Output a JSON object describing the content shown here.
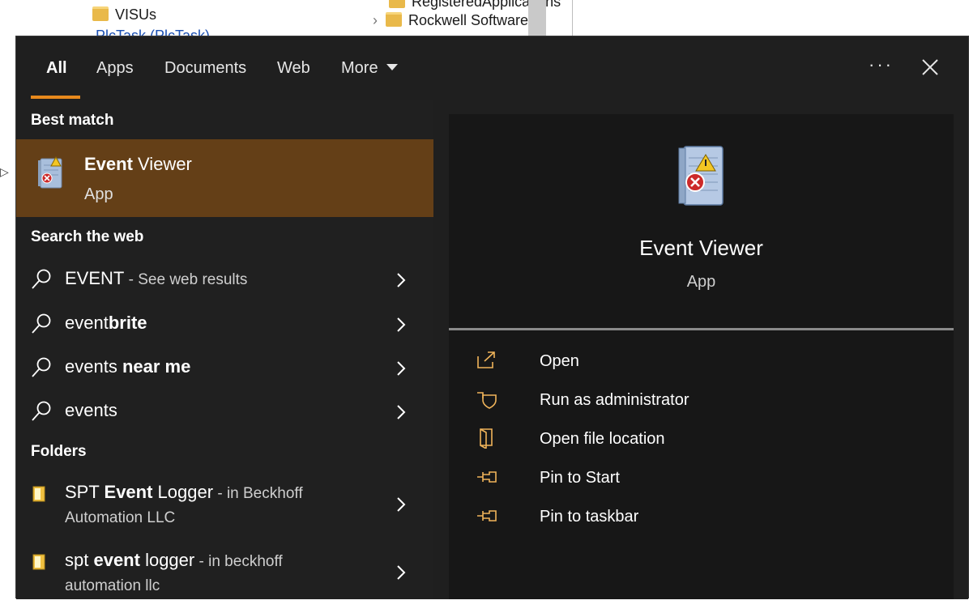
{
  "background": {
    "left_items": [
      "VISUs",
      "PlcTask (PlcTask)"
    ],
    "mid_items": [
      "RegisteredApplications",
      "Rockwell Software"
    ]
  },
  "tabs": [
    {
      "label": "All",
      "active": true
    },
    {
      "label": "Apps"
    },
    {
      "label": "Documents"
    },
    {
      "label": "Web"
    },
    {
      "label": "More"
    }
  ],
  "header": {
    "more_icon": "ellipsis-icon",
    "close_icon": "close-icon"
  },
  "best_match": {
    "section": "Best match",
    "title_bold": "Event",
    "title_rest": " Viewer",
    "subtitle": "App"
  },
  "search_web": {
    "section": "Search the web",
    "items": [
      {
        "normal": "EVENT",
        "bold": "",
        "suffix": " - See web results"
      },
      {
        "normal": "event",
        "bold": "brite",
        "suffix": ""
      },
      {
        "normal": "events ",
        "bold": "near me",
        "suffix": ""
      },
      {
        "normal": "events",
        "bold": "",
        "suffix": ""
      }
    ]
  },
  "folders": {
    "section": "Folders",
    "items": [
      {
        "pre": "SPT ",
        "bold": "Event",
        "post": " Logger",
        "suffix": " - in Beckhoff",
        "line2": "Automation LLC"
      },
      {
        "pre": "spt ",
        "bold": "event",
        "post": " logger",
        "suffix": " - in beckhoff",
        "line2": "automation llc"
      }
    ]
  },
  "preview": {
    "title": "Event Viewer",
    "subtitle": "App"
  },
  "actions": [
    {
      "label": "Open",
      "icon": "open-external-icon"
    },
    {
      "label": "Run as administrator",
      "icon": "shield-icon"
    },
    {
      "label": "Open file location",
      "icon": "file-location-icon"
    },
    {
      "label": "Pin to Start",
      "icon": "pin-icon"
    },
    {
      "label": "Pin to taskbar",
      "icon": "pin-icon"
    }
  ],
  "colors": {
    "accent": "#e8891c",
    "selection": "#643f17",
    "action_icon": "#f0b45a"
  }
}
